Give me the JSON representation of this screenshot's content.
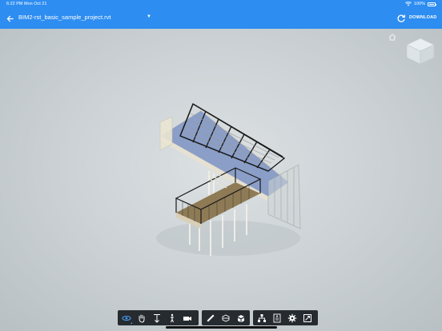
{
  "status_bar": {
    "time": "6:22 PM",
    "date": "Mon Oct 21",
    "battery": "100%"
  },
  "app_bar": {
    "title": "BIM2-rst_basic_sample_project.rvt",
    "download_label": "DOWNLOAD"
  },
  "colors": {
    "accent": "#2d8df1",
    "toolbar_bg": "#262b30",
    "active_tool": "#4aa3ff"
  },
  "viewer": {
    "model_name": "rst_basic_sample_project"
  },
  "toolbar_groups": [
    {
      "tools": [
        "orbit-icon",
        "pan-icon",
        "zoom-icon",
        "first-person-icon",
        "camera-icon"
      ]
    },
    {
      "tools": [
        "measure-icon",
        "section-icon",
        "explode-icon"
      ]
    },
    {
      "tools": [
        "model-browser-icon",
        "properties-icon",
        "settings-icon",
        "fullscreen-icon"
      ]
    }
  ]
}
